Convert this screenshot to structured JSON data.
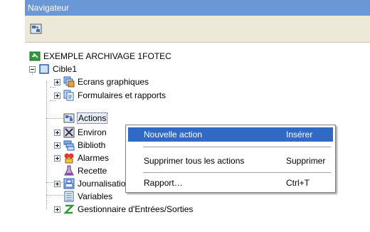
{
  "window": {
    "title": "Navigateur"
  },
  "toolbar": {
    "button_icon": "navigator-icon"
  },
  "tree": {
    "root": {
      "label": "EXEMPLE ARCHIVAGE 1FOTEC",
      "icon": "project-icon"
    },
    "target": {
      "label": "Cible1",
      "icon": "target-icon"
    },
    "items": [
      {
        "label": "Ecrans graphiques",
        "icon": "screens-icon"
      },
      {
        "label": "Formulaires et rapports",
        "icon": "forms-icon"
      },
      {
        "label": "Actions",
        "icon": "actions-icon",
        "selected": true
      },
      {
        "label": "Environ",
        "icon": "tools-icon"
      },
      {
        "label": "Biblioth",
        "icon": "library-icon"
      },
      {
        "label": "Alarmes",
        "icon": "alarm-icon"
      },
      {
        "label": "Recette",
        "icon": "recipe-icon"
      },
      {
        "label": "Journalisation des données",
        "icon": "logging-icon"
      },
      {
        "label": "Variables",
        "icon": "variables-icon"
      },
      {
        "label": "Gestionnaire d'Entrées/Sorties",
        "icon": "io-manager-icon"
      }
    ]
  },
  "context_menu": {
    "items": [
      {
        "label": "Nouvelle action",
        "shortcut": "Insérer"
      },
      {
        "label": "Supprimer tous les actions",
        "shortcut": "Supprimer"
      },
      {
        "label": "Rapport…",
        "shortcut": "Ctrl+T"
      }
    ]
  },
  "colors": {
    "titlebar": "#6a97d6",
    "toolbar": "#ece9d8",
    "menu_highlight": "#316ac5"
  }
}
